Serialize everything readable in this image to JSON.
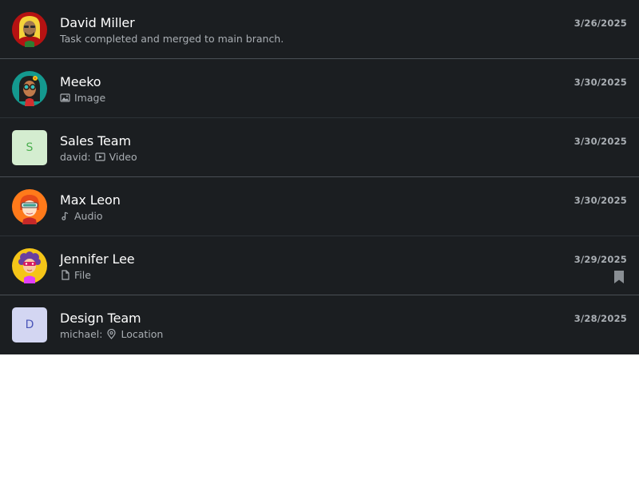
{
  "chats": [
    {
      "name": "David Miller",
      "preview": "Task completed and merged to main branch.",
      "date": "3/26/2025",
      "avatar_icon": "avatar-david-icon"
    },
    {
      "name": "Meeko",
      "preview": "Image",
      "preview_icon": "image-icon",
      "date": "3/30/2025",
      "avatar_icon": "avatar-meeko-icon"
    },
    {
      "name": "Sales Team",
      "sender": "david:",
      "preview": "Video",
      "preview_icon": "video-icon",
      "date": "3/30/2025",
      "avatar_letter": "S",
      "avatar_bg": "#d4edd0",
      "avatar_fg": "#4caf50"
    },
    {
      "name": "Max Leon",
      "preview": "Audio",
      "preview_icon": "music-note-icon",
      "date": "3/30/2025",
      "avatar_icon": "avatar-max-icon"
    },
    {
      "name": "Jennifer Lee",
      "preview": "File",
      "preview_icon": "file-icon",
      "date": "3/29/2025",
      "avatar_icon": "avatar-jennifer-icon",
      "bookmark_icon": "bookmark-icon"
    },
    {
      "name": "Design Team",
      "sender": "michael:",
      "preview": "Location",
      "preview_icon": "location-pin-icon",
      "date": "3/28/2025",
      "avatar_letter": "D",
      "avatar_bg": "#d3d6f2",
      "avatar_fg": "#4a55b8"
    }
  ],
  "colors": {
    "background": "#1b1e21",
    "text_primary": "#ffffff",
    "text_secondary": "#a9aeb3",
    "divider": "#2d3237"
  }
}
